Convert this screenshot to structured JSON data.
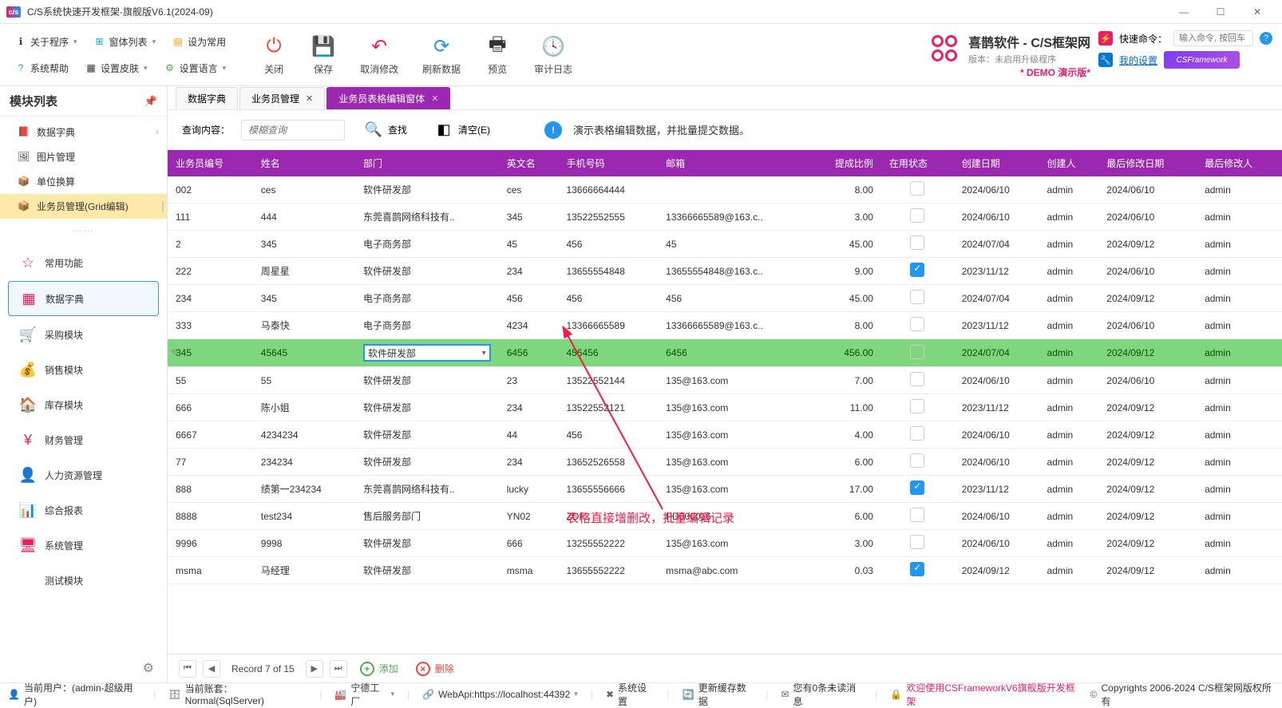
{
  "window": {
    "title": "C/S系统快速开发框架-旗舰版V6.1(2024-09)"
  },
  "ribbon": {
    "r1": {
      "about": "关于程序",
      "winlist": "窗体列表",
      "sethome": "设为常用"
    },
    "r2": {
      "help": "系统帮助",
      "skin": "设置皮肤",
      "lang": "设置语言"
    },
    "big": {
      "close": "关闭",
      "save": "保存",
      "cancel": "取消修改",
      "refresh": "刷新数据",
      "preview": "预览",
      "audit": "审计日志"
    },
    "brand": {
      "title": "喜鹊软件 - C/S框架网",
      "ver": "版本：未启用升级程序",
      "demo": "* DEMO 演示版*"
    },
    "quick": {
      "label": "快速命令：",
      "ph": "输入命令, 按回车",
      "settings": "我的设置",
      "csf": "CSFramework"
    }
  },
  "sidebar": {
    "title": "模块列表",
    "tree": [
      {
        "label": "数据字典",
        "hasChev": true
      },
      {
        "label": "图片管理"
      },
      {
        "label": "单位换算"
      },
      {
        "label": "业务员管理(Grid编辑)",
        "active": true
      }
    ],
    "nav": [
      {
        "label": "常用功能"
      },
      {
        "label": "数据字典",
        "sel": true
      },
      {
        "label": "采购模块"
      },
      {
        "label": "销售模块"
      },
      {
        "label": "库存模块"
      },
      {
        "label": "财务管理"
      },
      {
        "label": "人力资源管理"
      },
      {
        "label": "综合报表"
      },
      {
        "label": "系统管理"
      },
      {
        "label": "测试模块"
      }
    ]
  },
  "tabs": [
    {
      "label": "数据字典",
      "closable": false
    },
    {
      "label": "业务员管理",
      "closable": true
    },
    {
      "label": "业务员表格编辑窗体",
      "closable": true,
      "active": true
    }
  ],
  "search": {
    "label": "查询内容：",
    "ph": "模糊查询",
    "find": "查找",
    "clear": "清空(E)",
    "tip": "演示表格编辑数据，并批量提交数据。"
  },
  "cols": [
    "业务员编号",
    "姓名",
    "部门",
    "英文名",
    "手机号码",
    "邮箱",
    "提成比例",
    "在用状态",
    "创建日期",
    "创建人",
    "最后修改日期",
    "最后修改人"
  ],
  "rows": [
    {
      "id": "002",
      "name": "ces",
      "dept": "软件研发部",
      "en": "ces",
      "tel": "13666664444",
      "mail": "",
      "rate": "8.00",
      "on": false,
      "cd": "2024/06/10",
      "cu": "admin",
      "md": "2024/06/10",
      "mu": "admin"
    },
    {
      "id": "111",
      "name": "444",
      "dept": "东莞喜鹊网络科技有..",
      "en": "345",
      "tel": "13522552555",
      "mail": "13366665589@163.c..",
      "rate": "3.00",
      "on": false,
      "cd": "2024/06/10",
      "cu": "admin",
      "md": "2024/06/10",
      "mu": "admin"
    },
    {
      "id": "2",
      "name": "345",
      "dept": "电子商务部",
      "en": "45",
      "tel": "456",
      "mail": "45",
      "rate": "45.00",
      "on": false,
      "cd": "2024/07/04",
      "cu": "admin",
      "md": "2024/09/12",
      "mu": "admin"
    },
    {
      "id": "222",
      "name": "周星星",
      "dept": "软件研发部",
      "en": "234",
      "tel": "13655554848",
      "mail": "13655554848@163.c..",
      "rate": "9.00",
      "on": true,
      "cd": "2023/11/12",
      "cu": "admin",
      "md": "2024/06/10",
      "mu": "admin"
    },
    {
      "id": "234",
      "name": "345",
      "dept": "电子商务部",
      "en": "456",
      "tel": "456",
      "mail": "456",
      "rate": "45.00",
      "on": false,
      "cd": "2024/07/04",
      "cu": "admin",
      "md": "2024/09/12",
      "mu": "admin"
    },
    {
      "id": "333",
      "name": "马泰快",
      "dept": "电子商务部",
      "en": "4234",
      "tel": "13366665589",
      "mail": "13366665589@163.c..",
      "rate": "8.00",
      "on": false,
      "cd": "2023/11/12",
      "cu": "admin",
      "md": "2024/06/10",
      "mu": "admin"
    },
    {
      "id": "345",
      "name": "45645",
      "dept": "软件研发部",
      "en": "6456",
      "tel": "456456",
      "mail": "6456",
      "rate": "456.00",
      "on": false,
      "cd": "2024/07/04",
      "cu": "admin",
      "md": "2024/09/12",
      "mu": "admin",
      "editing": true
    },
    {
      "id": "55",
      "name": "55",
      "dept": "软件研发部",
      "en": "23",
      "tel": "13522552144",
      "mail": "135@163.com",
      "rate": "7.00",
      "on": false,
      "cd": "2024/06/10",
      "cu": "admin",
      "md": "2024/06/10",
      "mu": "admin"
    },
    {
      "id": "666",
      "name": "陈小姐",
      "dept": "软件研发部",
      "en": "234",
      "tel": "13522552121",
      "mail": "135@163.com",
      "rate": "11.00",
      "on": false,
      "cd": "2023/11/12",
      "cu": "admin",
      "md": "2024/09/12",
      "mu": "admin"
    },
    {
      "id": "6667",
      "name": "4234234",
      "dept": "软件研发部",
      "en": "44",
      "tel": "456",
      "mail": "135@163.com",
      "rate": "4.00",
      "on": false,
      "cd": "2024/06/10",
      "cu": "admin",
      "md": "2024/09/12",
      "mu": "admin"
    },
    {
      "id": "77",
      "name": "234234",
      "dept": "软件研发部",
      "en": "234",
      "tel": "13652526558",
      "mail": "135@163.com",
      "rate": "6.00",
      "on": false,
      "cd": "2024/06/10",
      "cu": "admin",
      "md": "2024/09/12",
      "mu": "admin"
    },
    {
      "id": "888",
      "name": "绩第一234234",
      "dept": "东莞喜鹊网络科技有..",
      "en": "lucky",
      "tel": "13655556666",
      "mail": "135@163.com",
      "rate": "17.00",
      "on": true,
      "cd": "2023/11/12",
      "cu": "admin",
      "md": "2024/09/12",
      "mu": "admin"
    },
    {
      "id": "8888",
      "name": "test234",
      "dept": "售后服务部门",
      "en": "YN02",
      "tel": "ZDF",
      "mail": "PD000016",
      "rate": "6.00",
      "on": false,
      "cd": "2024/06/10",
      "cu": "admin",
      "md": "2024/09/12",
      "mu": "admin"
    },
    {
      "id": "9996",
      "name": "9998",
      "dept": "软件研发部",
      "en": "666",
      "tel": "13255552222",
      "mail": "135@163.com",
      "rate": "3.00",
      "on": false,
      "cd": "2024/06/10",
      "cu": "admin",
      "md": "2024/09/12",
      "mu": "admin"
    },
    {
      "id": "msma",
      "name": "马经理",
      "dept": "软件研发部",
      "en": "msma",
      "tel": "13655552222",
      "mail": "msma@abc.com",
      "rate": "0.03",
      "on": true,
      "cd": "2024/09/12",
      "cu": "admin",
      "md": "2024/09/12",
      "mu": "admin"
    }
  ],
  "annotation": "表格直接增删改，批量编辑记录",
  "pager": {
    "info": "Record 7 of 15",
    "add": "添加",
    "del": "删除"
  },
  "status": {
    "user": "当前用户：(admin-超级用户)",
    "db": "当前账套：Normal(SqlServer)",
    "factory": "宁德工厂",
    "api": "WebApi:https://localhost:44392",
    "sys": "系统设置",
    "cache": "更新缓存数据",
    "msg": "您有0条未读消息",
    "welcome": "欢迎使用CSFrameworkV6旗舰版开发框架",
    "copy": "Copyrights 2006-2024 C/S框架网版权所有"
  }
}
